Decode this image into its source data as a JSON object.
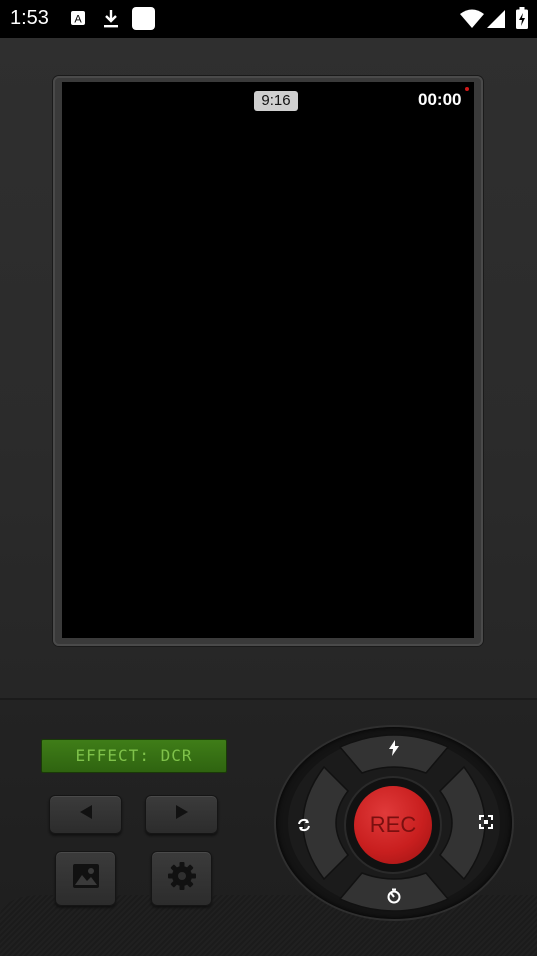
{
  "status_bar": {
    "time": "1:53",
    "icons": [
      "a-icon",
      "download-icon",
      "app-square-icon",
      "wifi-icon",
      "signal-icon",
      "battery-charging-icon"
    ]
  },
  "viewfinder": {
    "aspect_ratio": "9:16",
    "record_time": "00:00"
  },
  "controls": {
    "effect_label": "EFFECT:  DCR",
    "rec_label": "REC",
    "buttons": [
      "previous-effect-button",
      "next-effect-button",
      "gallery-button",
      "settings-button",
      "flash-button",
      "switch-camera-button",
      "fullscreen-button",
      "timer-button"
    ]
  },
  "colors": {
    "rec_red": "#c91f1f",
    "lcd_green": "#3f7d18",
    "lcd_text": "#7fc24a"
  }
}
